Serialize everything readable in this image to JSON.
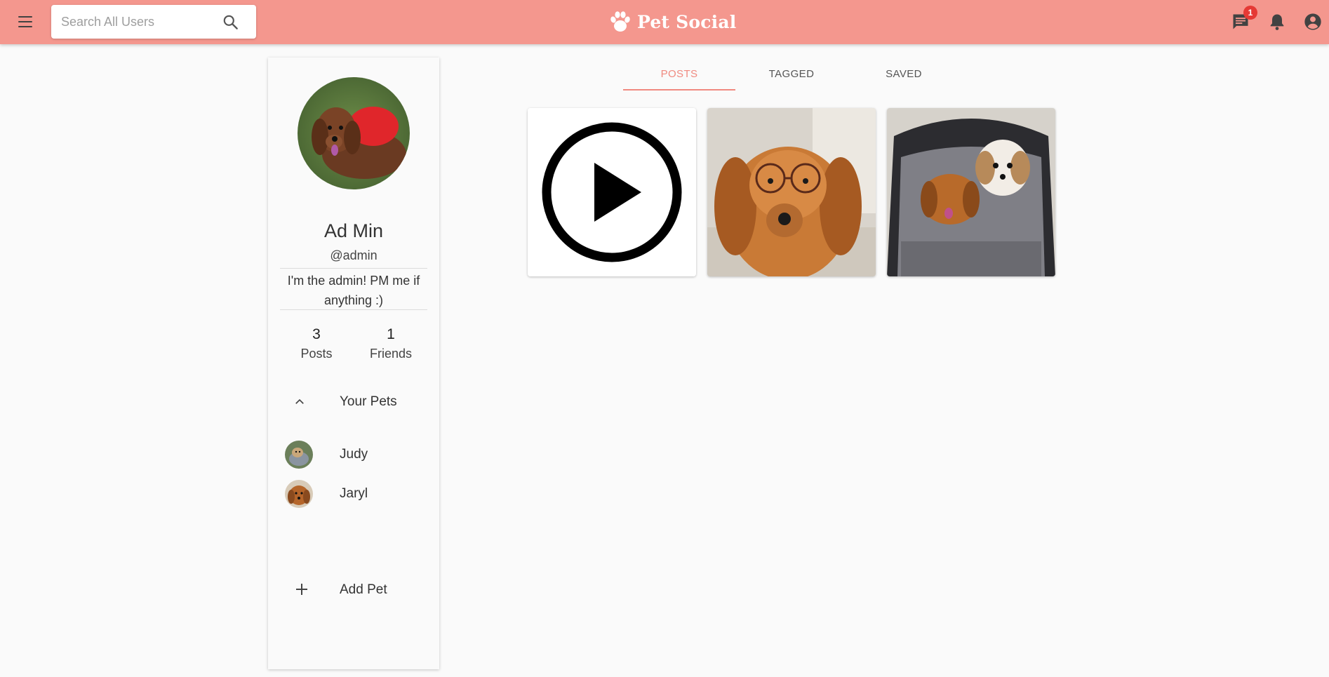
{
  "header": {
    "brand": "Pet Social",
    "search_placeholder": "Search All Users",
    "messages_badge": "1",
    "background_color": "#f4978e"
  },
  "profile": {
    "name": "Ad Min",
    "handle": "@admin",
    "bio": "I'm the admin! PM me if anything :)",
    "stats": [
      {
        "value": "3",
        "label": "Posts"
      },
      {
        "value": "1",
        "label": "Friends"
      }
    ]
  },
  "pets": {
    "section_label": "Your Pets",
    "items": [
      {
        "name": "Judy"
      },
      {
        "name": "Jaryl"
      }
    ],
    "add_label": "Add Pet"
  },
  "tabs": [
    {
      "label": "POSTS",
      "active": true
    },
    {
      "label": "TAGGED",
      "active": false
    },
    {
      "label": "SAVED",
      "active": false
    }
  ],
  "posts": [
    {
      "kind": "video",
      "icon": "play-circle-icon"
    },
    {
      "kind": "photo",
      "subject": "dachshund wearing glasses"
    },
    {
      "kind": "photo",
      "subject": "two dogs in a stroller"
    }
  ],
  "colors": {
    "accent": "#f08a80",
    "badge": "#e53935"
  }
}
